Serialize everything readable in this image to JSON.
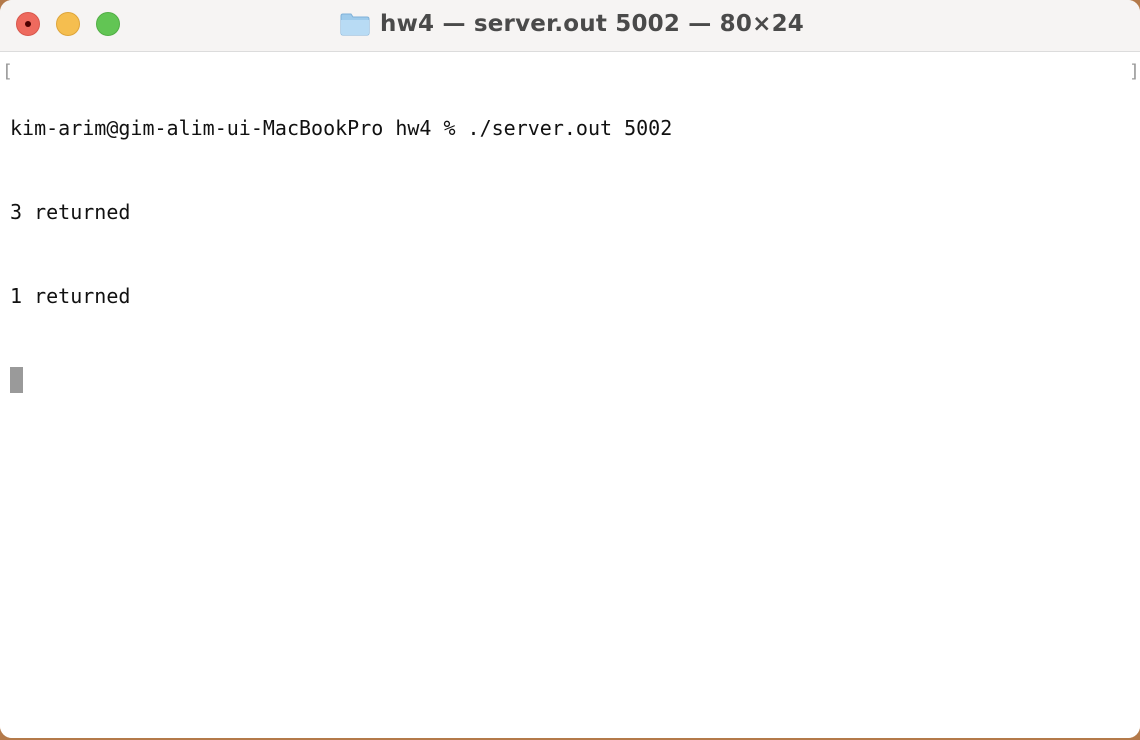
{
  "window": {
    "title": "hw4 — server.out 5002 — 80×24",
    "title_icon": "folder-icon",
    "controls": {
      "close": "close-icon",
      "minimize": "minimize-icon",
      "zoom": "zoom-icon"
    }
  },
  "terminal": {
    "lines": [
      "kim-arim@gim-alim-ui-MacBookPro hw4 % ./server.out 5002",
      "3 returned",
      "1 returned"
    ],
    "left_bracket": "[",
    "right_bracket": "]"
  },
  "colors": {
    "titlebar": "#f6f4f3",
    "close": "#ee6a5e",
    "minimize": "#f5be4f",
    "zoom": "#62c554",
    "cursor": "#9a9a9a"
  }
}
